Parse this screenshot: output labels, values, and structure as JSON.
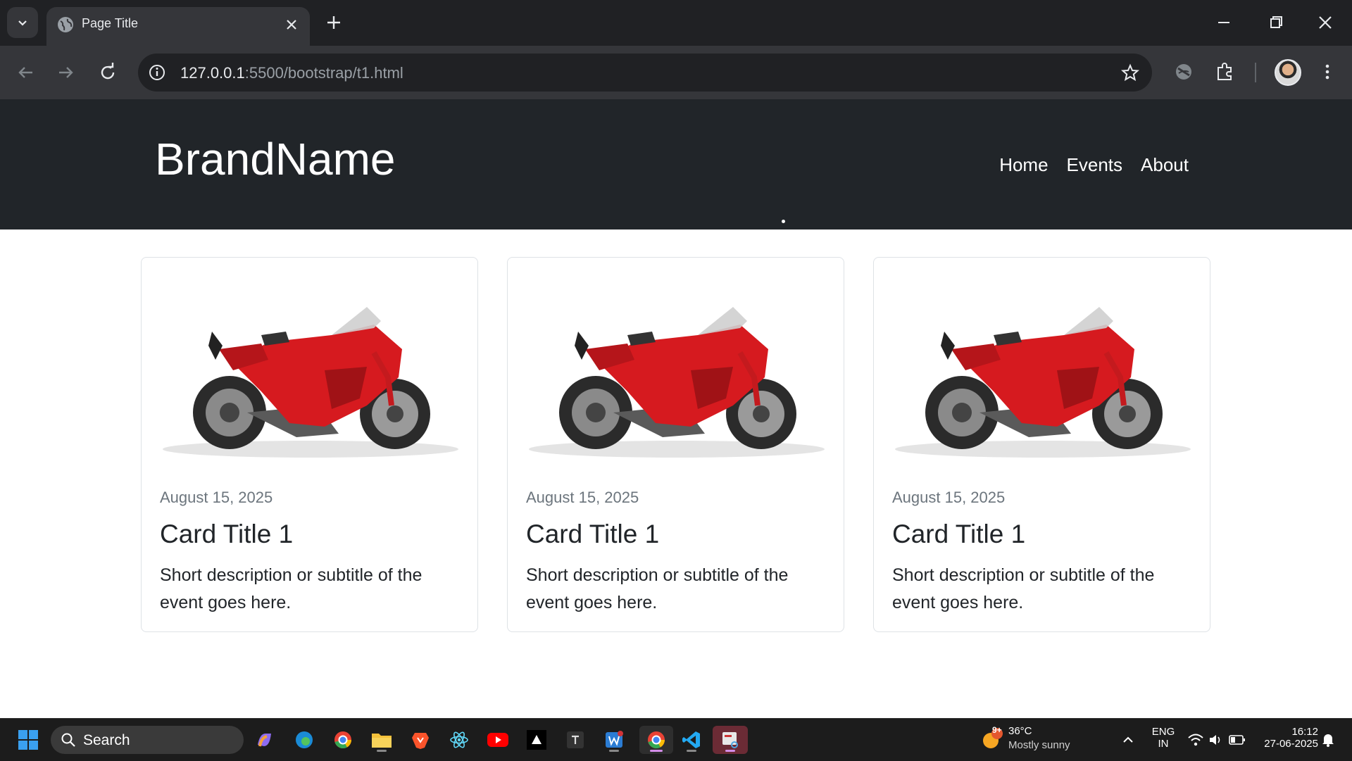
{
  "browser": {
    "tab_title": "Page Title",
    "url_host": "127.0.0.1",
    "url_rest": ":5500/bootstrap/t1.html"
  },
  "navbar": {
    "brand": "BrandName",
    "links": [
      "Home",
      "Events",
      "About"
    ]
  },
  "cards": [
    {
      "date": "August 15, 2025",
      "title": "Card Title 1",
      "description": "Short description or subtitle of the event goes here."
    },
    {
      "date": "August 15, 2025",
      "title": "Card Title 1",
      "description": "Short description or subtitle of the event goes here."
    },
    {
      "date": "August 15, 2025",
      "title": "Card Title 1",
      "description": "Short description or subtitle of the event goes here."
    }
  ],
  "taskbar": {
    "search_label": "Search",
    "weather_temp": "36°C",
    "weather_desc": "Mostly sunny",
    "weather_badge": "9+",
    "lang_1": "ENG",
    "lang_2": "IN",
    "time": "16:12",
    "date": "27-06-2025"
  },
  "colors": {
    "navbar_bg": "#212529",
    "motorcycle_red": "#d61a1f"
  }
}
